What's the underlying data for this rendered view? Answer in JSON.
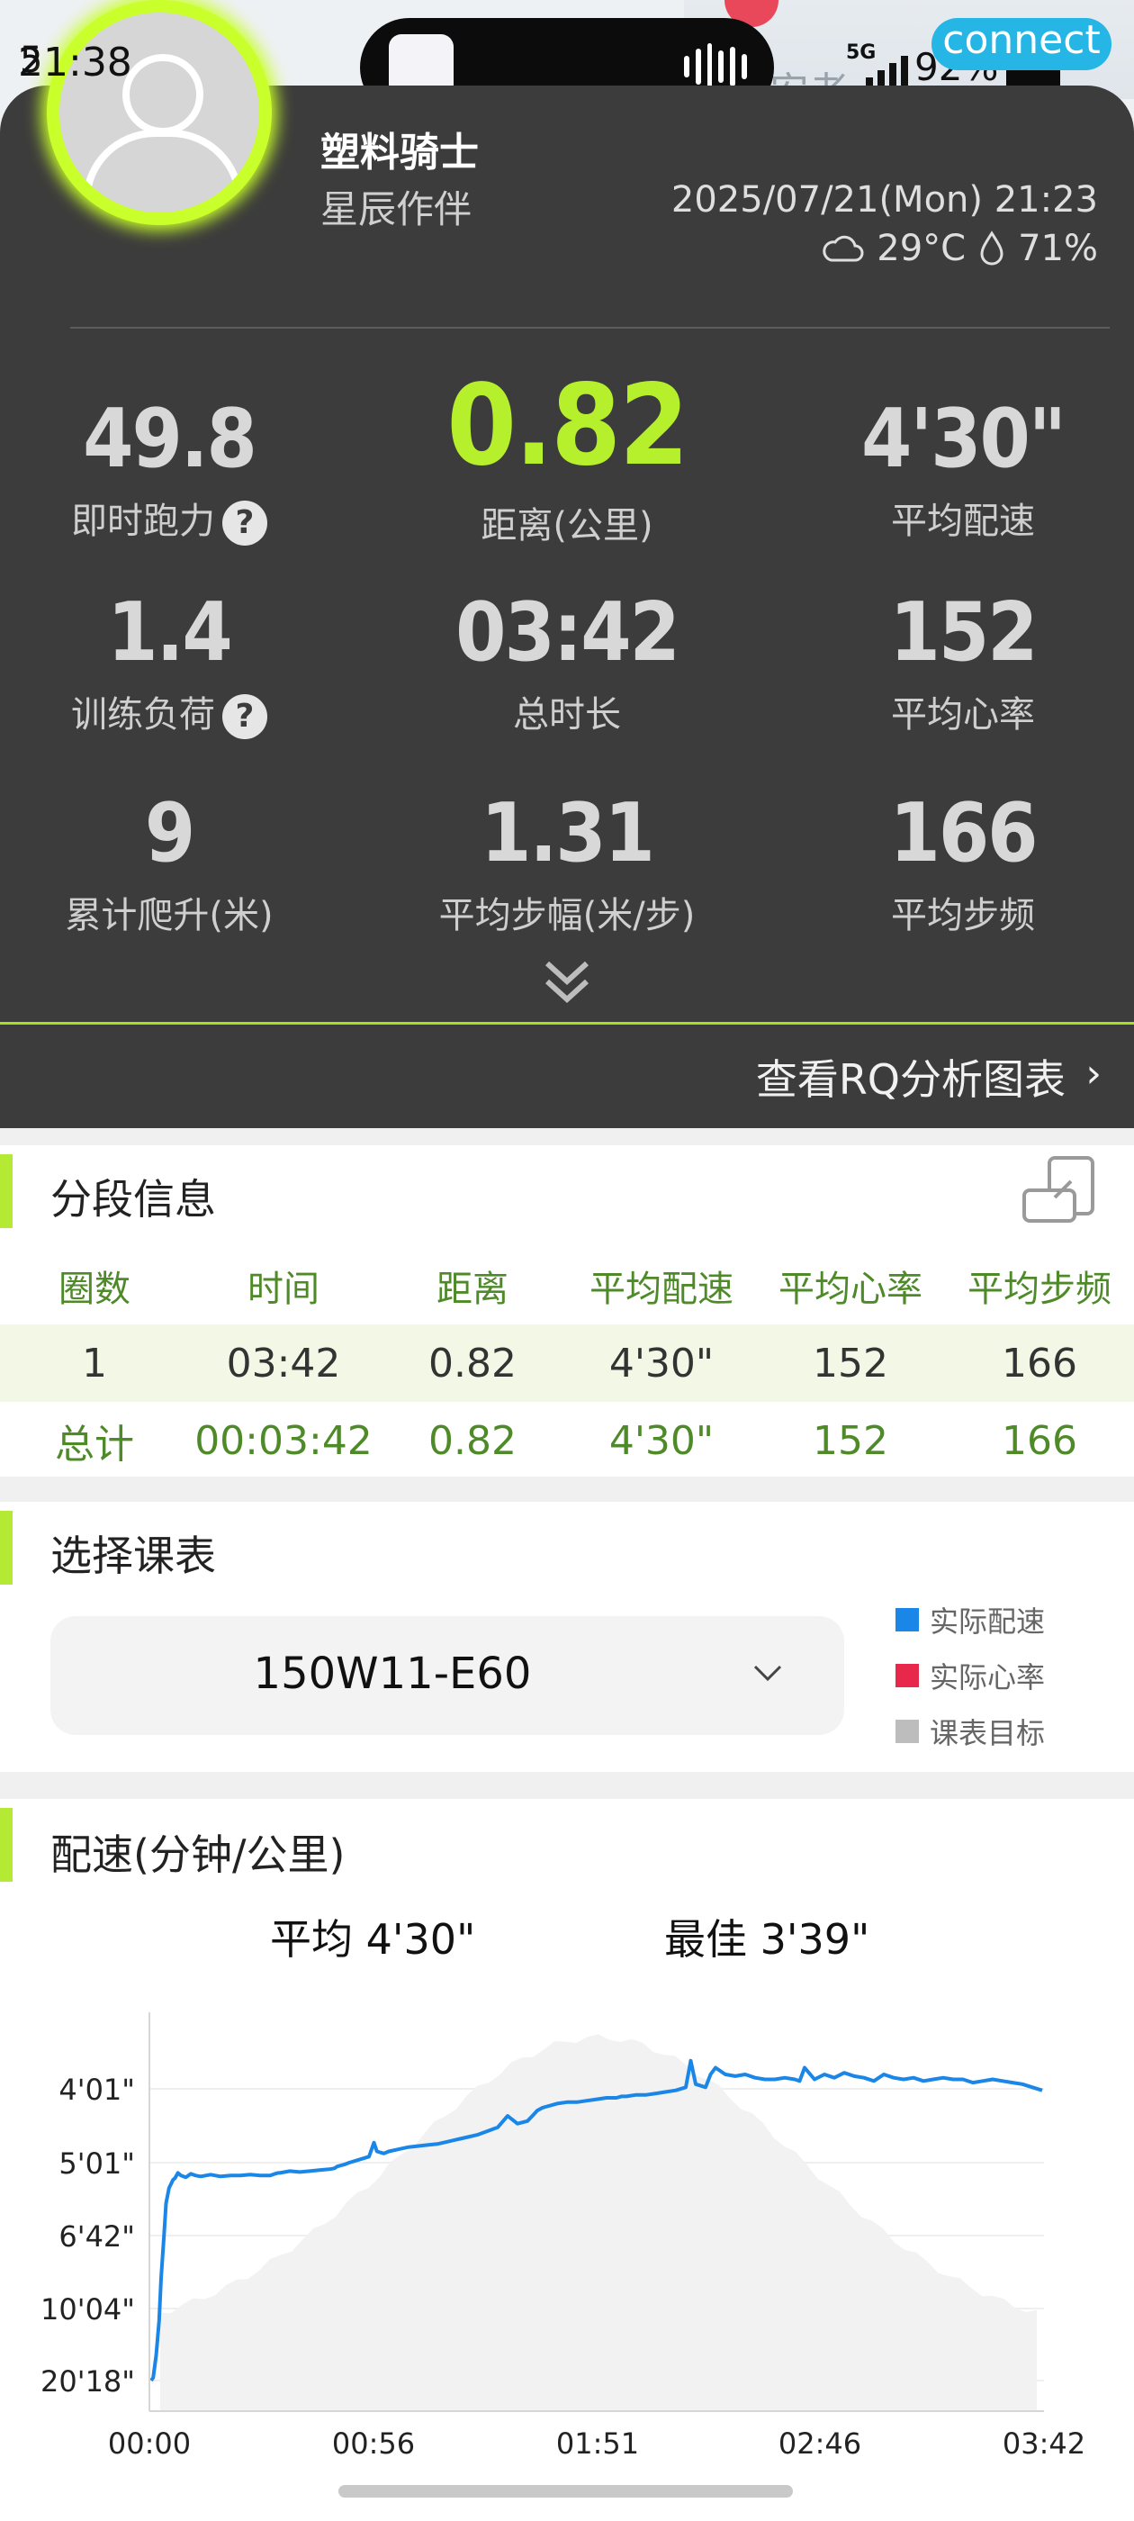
{
  "status_bar": {
    "time": "21:38",
    "time_fragment": "5",
    "network": "5G",
    "battery_pct": "92%",
    "badge": "connect",
    "map_text": "安老"
  },
  "profile": {
    "name": "塑料骑士",
    "title": "星辰作伴",
    "date": "2025/07/21(Mon) 21:23",
    "temperature": "29°C",
    "humidity": "71%"
  },
  "metrics": {
    "running_power": {
      "value": "49.8",
      "label": "即时跑力"
    },
    "distance": {
      "value": "0.82",
      "label": "距离(公里)"
    },
    "avg_pace": {
      "value": "4'30\"",
      "label": "平均配速"
    },
    "training_load": {
      "value": "1.4",
      "label": "训练负荷"
    },
    "duration": {
      "value": "03:42",
      "label": "总时长"
    },
    "avg_hr": {
      "value": "152",
      "label": "平均心率"
    },
    "elevation": {
      "value": "9",
      "label": "累计爬升(米)"
    },
    "stride": {
      "value": "1.31",
      "label": "平均步幅(米/步)"
    },
    "cadence": {
      "value": "166",
      "label": "平均步频"
    }
  },
  "rq_link": "查看RQ分析图表",
  "splits": {
    "title": "分段信息",
    "headers": [
      "圈数",
      "时间",
      "距离",
      "平均配速",
      "平均心率",
      "平均步频"
    ],
    "lap": [
      "1",
      "03:42",
      "0.82",
      "4'30\"",
      "152",
      "166"
    ],
    "total": [
      "总计",
      "00:03:42",
      "0.82",
      "4'30\"",
      "152",
      "166"
    ]
  },
  "plan": {
    "title": "选择课表",
    "selected": "150W11-E60",
    "legend": [
      {
        "label": "实际配速",
        "color": "#1a86e8"
      },
      {
        "label": "实际心率",
        "color": "#e8284a"
      },
      {
        "label": "课表目标",
        "color": "#bdbdbd"
      }
    ]
  },
  "pace_chart": {
    "title": "配速(分钟/公里)",
    "avg_label": "平均 4'30\"",
    "best_label": "最佳 3'39\""
  },
  "colors": {
    "accent": "#b4ea33",
    "highlight": "#c9ff2a",
    "pace_line": "#1a86e8",
    "table_green": "#4f8a29"
  },
  "chart_data": {
    "type": "line",
    "title": "配速(分钟/公里)",
    "x_unit": "elapsed time (mm:ss)",
    "x_ticks": [
      "00:00",
      "00:56",
      "01:51",
      "02:46",
      "03:42"
    ],
    "y_ticks": [
      "4'01\"",
      "5'01\"",
      "6'42\"",
      "10'04\"",
      "20'18\""
    ],
    "y_note": "axis is reciprocal pace (speed); faster pace plotted higher",
    "series": [
      {
        "name": "实际配速",
        "color": "#1a86e8",
        "x_sec": [
          0,
          2,
          5,
          8,
          10,
          13,
          15,
          18,
          20,
          22,
          24,
          27,
          30,
          35,
          40,
          45,
          50,
          55,
          60,
          70,
          80,
          90,
          100,
          110,
          120,
          125,
          128,
          130,
          140,
          150,
          160,
          170,
          180,
          185,
          188,
          195,
          200,
          210,
          220,
          225,
          228,
          235,
          240,
          250,
          260,
          270,
          280,
          290,
          300,
          310,
          320,
          330,
          340,
          350,
          360,
          370,
          380,
          385,
          390,
          395,
          400,
          410,
          420,
          430,
          440,
          450,
          460,
          470,
          475,
          480,
          490,
          500,
          510,
          520,
          530,
          540,
          545,
          550,
          560,
          565,
          570,
          580,
          590,
          600,
          610,
          620,
          630,
          640,
          650,
          655,
          660,
          670,
          680,
          690,
          700,
          710,
          720,
          730,
          740,
          750,
          760,
          770,
          780,
          790,
          800,
          810,
          820,
          830,
          840,
          850,
          860,
          870,
          880,
          890,
          900
        ],
        "pace": [
          "20'18\"",
          "19'30\"",
          "15'00\"",
          "11'00\"",
          "8'20\"",
          "6'40\"",
          "5'50\"",
          "5'30\"",
          "5'25\"",
          "5'20\"",
          "5'18\"",
          "5'12\"",
          "5'15\"",
          "5'17\"",
          "5'13\"",
          "5'15\"",
          "5'16\"",
          "5'15\"",
          "5'14\"",
          "5'16\"",
          "5'15\"",
          "5'15\"",
          "5'14\"",
          "5'15\"",
          "5'15\"",
          "5'13\"",
          "5'12\"",
          "5'12\"",
          "5'10\"",
          "5'11\"",
          "5'10\"",
          "5'09\"",
          "5'08\"",
          "5'07\"",
          "5'05\"",
          "5'03\"",
          "5'01\"",
          "4'58\"",
          "4'55\"",
          "4'42\"",
          "4'50\"",
          "4'52\"",
          "4'50\"",
          "4'48\"",
          "4'46\"",
          "4'45\"",
          "4'44\"",
          "4'43\"",
          "4'41\"",
          "4'39\"",
          "4'37\"",
          "4'35\"",
          "4'32\"",
          "4'29\"",
          "4'20\"",
          "4'26\"",
          "4'24\"",
          "4'20\"",
          "4'16\"",
          "4'14\"",
          "4'13\"",
          "4'11\"",
          "4'10\"",
          "4'10\"",
          "4'09\"",
          "4'08\"",
          "4'07\"",
          "4'07\"",
          "4'06\"",
          "4'06\"",
          "4'05\"",
          "4'05\"",
          "4'04\"",
          "4'03\"",
          "4'02\"",
          "4'00\"",
          "3'44\"",
          "3'58\"",
          "4'00\"",
          "3'52\"",
          "3'48\"",
          "3'52\"",
          "3'53\"",
          "3'52\"",
          "3'54\"",
          "3'55\"",
          "3'55\"",
          "3'54\"",
          "3'55\"",
          "3'56\"",
          "3'48\"",
          "3'55\"",
          "3'52\"",
          "3'54\"",
          "3'51\"",
          "3'53\"",
          "3'54\"",
          "3'56\"",
          "3'52\"",
          "3'54\"",
          "3'55\"",
          "3'54\"",
          "3'56\"",
          "3'55\"",
          "3'54\"",
          "3'55\"",
          "3'55\"",
          "3'57\"",
          "3'56\"",
          "3'55\"",
          "3'56\"",
          "3'57\"",
          "3'58\"",
          "4'00\"",
          "4'02\""
        ]
      }
    ],
    "background_area": "课表目标 (grey plan profile)"
  }
}
